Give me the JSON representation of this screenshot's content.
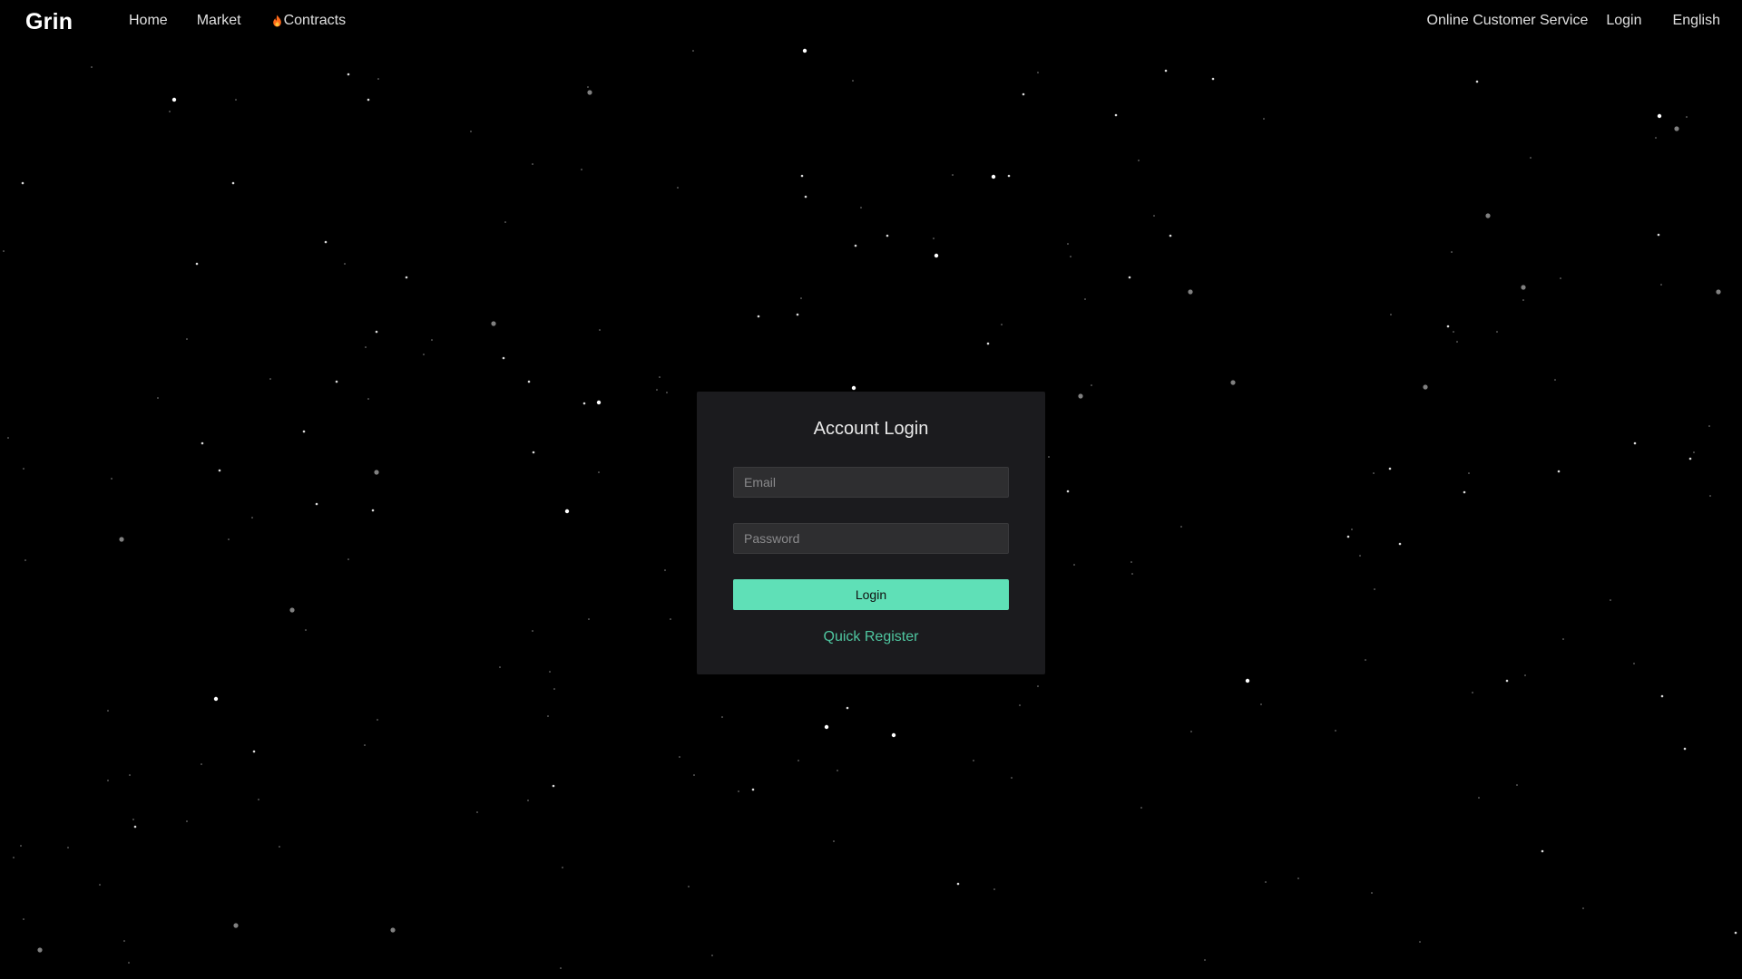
{
  "header": {
    "brand": "Grin",
    "nav_left": [
      {
        "label": "Home"
      },
      {
        "label": "Market"
      },
      {
        "label": "Contracts",
        "icon": "flame-icon"
      }
    ],
    "nav_right": [
      {
        "label": "Online Customer Service"
      },
      {
        "label": "Login"
      },
      {
        "label": "English"
      }
    ]
  },
  "login_card": {
    "title": "Account Login",
    "email_placeholder": "Email",
    "email_value": "",
    "password_placeholder": "Password",
    "password_value": "",
    "login_button": "Login",
    "register_link": "Quick Register"
  },
  "colors": {
    "background": "#000000",
    "card_background": "#1b1b1e",
    "input_background": "#2e2e30",
    "accent": "#5fe0b7",
    "link": "#4fc6a0",
    "flame": "#ff6a1a"
  }
}
